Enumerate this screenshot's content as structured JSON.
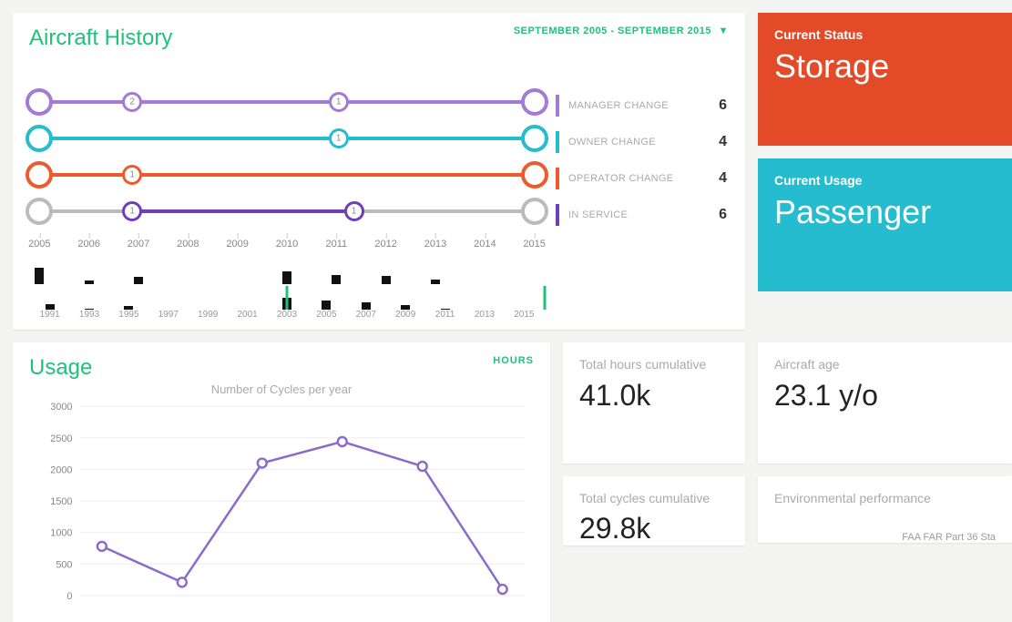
{
  "history": {
    "title": "Aircraft History",
    "date_range": "SEPTEMBER 2005 - SEPTEMBER 2015",
    "legend": [
      {
        "label": "MANAGER CHANGE",
        "count": "6",
        "color": "#a37bd6"
      },
      {
        "label": "OWNER CHANGE",
        "count": "4",
        "color": "#25bccf"
      },
      {
        "label": "OPERATOR CHANGE",
        "count": "4",
        "color": "#ef5a2d"
      },
      {
        "label": "IN SERVICE",
        "count": "6",
        "color": "#6f3fb8"
      }
    ],
    "timeline_years": [
      "2005",
      "2006",
      "2007",
      "2008",
      "2009",
      "2010",
      "2011",
      "2012",
      "2013",
      "2014",
      "2015"
    ],
    "spark_top_years": [
      "2005",
      "2006",
      "2007",
      "2008",
      "2009",
      "2010",
      "2011",
      "2012",
      "2013",
      "2014",
      "2015"
    ],
    "spark_bot_years": [
      "1991",
      "1993",
      "1995",
      "1997",
      "1999",
      "2001",
      "2003",
      "2005",
      "2007",
      "2009",
      "2011",
      "2013",
      "2015"
    ],
    "timeline_points": {
      "manager": [
        {
          "x": 20,
          "label": "2"
        },
        {
          "x": 60,
          "label": "1"
        }
      ],
      "owner": [
        {
          "x": 60,
          "label": "1"
        }
      ],
      "operator": [
        {
          "x": 20,
          "label": "1"
        }
      ],
      "inservice": [
        {
          "x": 20,
          "label": "1"
        },
        {
          "x": 63,
          "label": "1"
        }
      ]
    }
  },
  "status": {
    "status_label": "Current Status",
    "status_value": "Storage",
    "usage_label": "Current Usage",
    "usage_value": "Passenger"
  },
  "usage": {
    "title": "Usage",
    "subtitle": "Number of Cycles per year",
    "chip": "HOURS"
  },
  "metrics": {
    "total_hours_label": "Total hours cumulative",
    "total_hours_value": "41.0k",
    "total_cycles_label": "Total cycles cumulative",
    "total_cycles_value": "29.8k",
    "age_label": "Aircraft age",
    "age_value": "23.1 y/o",
    "env_label": "Environmental performance",
    "env_line": "FAA FAR Part 36 Sta"
  },
  "chart_data": [
    {
      "type": "line",
      "title": "Number of Cycles per year",
      "xlabel": "",
      "ylabel": "",
      "ylim": [
        0,
        3000
      ],
      "x": [
        1,
        2,
        3,
        4,
        5,
        6
      ],
      "values": [
        780,
        210,
        2100,
        2440,
        2050,
        100
      ]
    },
    {
      "type": "bar",
      "title": "Aircraft History sparkline",
      "categories": [
        "2005",
        "2006",
        "2007",
        "2008",
        "2009",
        "2010",
        "2011",
        "2012",
        "2013",
        "2014",
        "2015"
      ],
      "values": [
        18,
        4,
        8,
        0,
        0,
        14,
        10,
        9,
        5,
        0,
        0
      ]
    }
  ]
}
